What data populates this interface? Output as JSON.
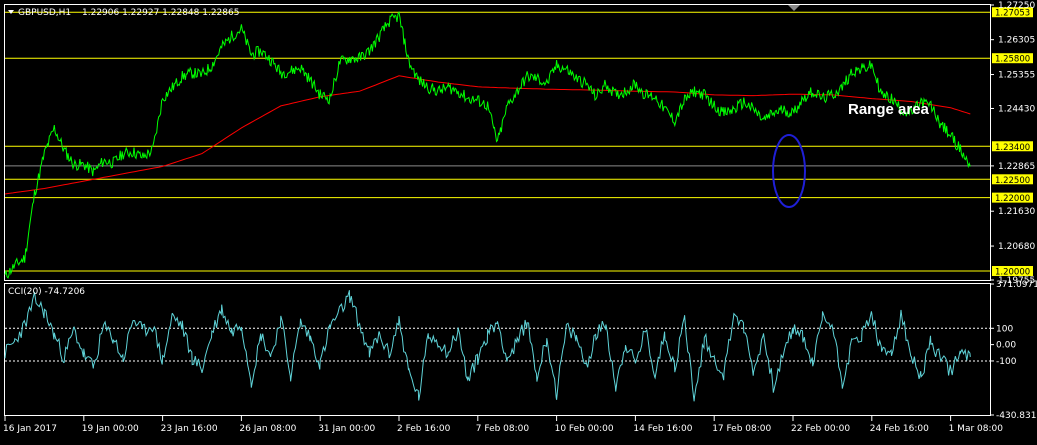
{
  "header": {
    "symbol": "GBPUSD,H1",
    "ohlc": "1.22906 1.22927 1.22848 1.22865"
  },
  "chart_data": {
    "type": "line",
    "title": "GBPUSD,H1",
    "colors": {
      "price": "#00ff00",
      "ma": "#ff0000",
      "levels": "#ffff00",
      "level_label_bg": "#ffff00",
      "current_price_line": "#8a8a8a",
      "cci": "#5fd3d8",
      "circle": "#1f1fd6",
      "grid_frame": "#ffffff"
    },
    "price_axis": {
      "ylim": [
        1.19755,
        1.2725
      ],
      "ticks": [
        "1.27250",
        "1.26305",
        "1.25355",
        "1.24430",
        "1.22865",
        "1.21630",
        "1.20680",
        "1.19755"
      ]
    },
    "levels": [
      1.27053,
      1.258,
      1.234,
      1.225,
      1.22,
      1.2
    ],
    "level_labels": [
      "1.27053",
      "1.25800",
      "1.23400",
      "1.22500",
      "1.22000",
      "1.20000"
    ],
    "current_price": 1.22865,
    "current_price_label": "1.22865",
    "x_labels": [
      "16 Jan 2017",
      "19 Jan 00:00",
      "23 Jan 16:00",
      "26 Jan 08:00",
      "31 Jan 00:00",
      "2 Feb 16:00",
      "7 Feb 08:00",
      "10 Feb 00:00",
      "14 Feb 16:00",
      "17 Feb 08:00",
      "22 Feb 00:00",
      "24 Feb 16:00",
      "1 Mar 08:00"
    ],
    "x_label_index": [
      0,
      40,
      80,
      120,
      160,
      200,
      240,
      280,
      320,
      360,
      400,
      440,
      480
    ],
    "n_bars": 500,
    "price_series": {
      "name": "GBPUSD",
      "x": [
        0,
        5,
        10,
        15,
        20,
        25,
        30,
        35,
        40,
        45,
        50,
        55,
        60,
        65,
        70,
        75,
        80,
        85,
        90,
        95,
        100,
        105,
        110,
        115,
        120,
        125,
        130,
        135,
        140,
        145,
        150,
        155,
        160,
        165,
        170,
        175,
        180,
        185,
        190,
        195,
        200,
        205,
        210,
        215,
        220,
        225,
        230,
        235,
        240,
        245,
        250,
        255,
        260,
        265,
        270,
        275,
        280,
        285,
        290,
        295,
        300,
        305,
        310,
        315,
        320,
        325,
        330,
        335,
        340,
        345,
        350,
        355,
        360,
        365,
        370,
        375,
        380,
        385,
        390,
        395,
        400,
        405,
        410,
        415,
        420,
        425,
        430,
        435,
        440,
        445,
        450,
        455,
        460,
        465,
        470,
        475,
        480,
        485,
        490
      ],
      "y": [
        1.1985,
        1.2015,
        1.2035,
        1.221,
        1.232,
        1.239,
        1.233,
        1.229,
        1.229,
        1.227,
        1.23,
        1.2295,
        1.232,
        1.2325,
        1.231,
        1.233,
        1.247,
        1.25,
        1.253,
        1.254,
        1.2535,
        1.256,
        1.261,
        1.264,
        1.266,
        1.259,
        1.26,
        1.2575,
        1.254,
        1.2545,
        1.2555,
        1.252,
        1.248,
        1.247,
        1.257,
        1.258,
        1.258,
        1.26,
        1.264,
        1.268,
        1.2695,
        1.257,
        1.252,
        1.25,
        1.249,
        1.25,
        1.249,
        1.247,
        1.2465,
        1.245,
        1.235,
        1.245,
        1.249,
        1.253,
        1.2525,
        1.251,
        1.256,
        1.255,
        1.2525,
        1.251,
        1.2475,
        1.251,
        1.248,
        1.249,
        1.251,
        1.248,
        1.2475,
        1.244,
        1.241,
        1.2465,
        1.249,
        1.248,
        1.245,
        1.243,
        1.244,
        1.246,
        1.244,
        1.241,
        1.243,
        1.244,
        1.243,
        1.247,
        1.249,
        1.247,
        1.248,
        1.25,
        1.2545,
        1.255,
        1.256,
        1.248,
        1.247,
        1.244,
        1.243,
        1.246,
        1.245,
        1.24,
        1.237,
        1.233,
        1.2285
      ]
    },
    "ma_series": {
      "name": "MA",
      "x": [
        0,
        20,
        40,
        60,
        80,
        100,
        120,
        140,
        160,
        180,
        200,
        220,
        240,
        260,
        280,
        300,
        320,
        340,
        360,
        380,
        400,
        420,
        440,
        460,
        480,
        490
      ],
      "y": [
        1.221,
        1.2225,
        1.2245,
        1.2265,
        1.2285,
        1.232,
        1.239,
        1.245,
        1.2475,
        1.249,
        1.2532,
        1.2515,
        1.2502,
        1.2498,
        1.2495,
        1.2493,
        1.249,
        1.2488,
        1.248,
        1.2478,
        1.2482,
        1.248,
        1.247,
        1.2462,
        1.2445,
        1.2428
      ]
    },
    "cci": {
      "label": "CCI(20) -74.7206",
      "ylim": [
        -430.8316,
        371.0971
      ],
      "ticks": [
        "371.0971",
        "100",
        "0.00",
        "-100",
        "-430.8316"
      ],
      "levels": [
        100,
        -100
      ],
      "x": [
        0,
        5,
        10,
        15,
        20,
        25,
        30,
        35,
        40,
        45,
        50,
        55,
        60,
        65,
        70,
        75,
        80,
        85,
        90,
        95,
        100,
        105,
        110,
        115,
        120,
        125,
        130,
        135,
        140,
        145,
        150,
        155,
        160,
        165,
        170,
        175,
        180,
        185,
        190,
        195,
        200,
        205,
        210,
        215,
        220,
        225,
        230,
        235,
        240,
        245,
        250,
        255,
        260,
        265,
        270,
        275,
        280,
        285,
        290,
        295,
        300,
        305,
        310,
        315,
        320,
        325,
        330,
        335,
        340,
        345,
        350,
        355,
        360,
        365,
        370,
        375,
        380,
        385,
        390,
        395,
        400,
        405,
        410,
        415,
        420,
        425,
        430,
        435,
        440,
        445,
        450,
        455,
        460,
        465,
        470,
        475,
        480,
        485,
        490
      ],
      "y": [
        -50,
        20,
        120,
        280,
        200,
        60,
        -80,
        90,
        -60,
        -140,
        110,
        40,
        -90,
        160,
        80,
        120,
        -100,
        180,
        110,
        -80,
        -150,
        70,
        220,
        80,
        130,
        -220,
        60,
        -70,
        160,
        -190,
        140,
        40,
        -120,
        110,
        200,
        300,
        120,
        -60,
        60,
        -60,
        150,
        -170,
        -320,
        60,
        20,
        -50,
        90,
        -220,
        -80,
        60,
        140,
        -90,
        10,
        150,
        -200,
        40,
        -300,
        100,
        40,
        -130,
        60,
        130,
        -260,
        10,
        -120,
        90,
        -180,
        70,
        -140,
        160,
        -340,
        40,
        -90,
        -180,
        200,
        100,
        -170,
        60,
        -250,
        -70,
        100,
        50,
        -120,
        170,
        120,
        -230,
        10,
        60,
        190,
        -60,
        -40,
        180,
        -80,
        -200,
        20,
        -90,
        -160,
        -50,
        -75
      ]
    },
    "annotation": "Range area"
  }
}
